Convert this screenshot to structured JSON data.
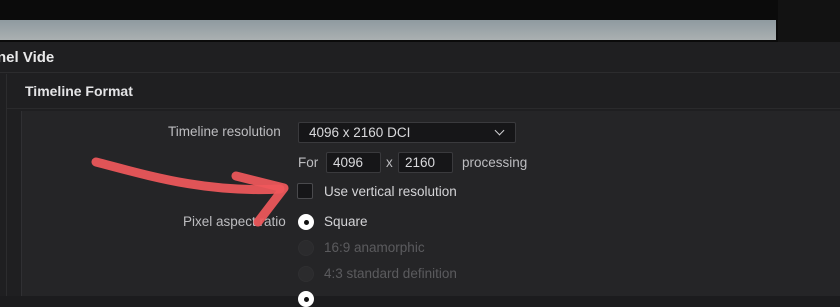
{
  "window": {
    "title": "nel Vide"
  },
  "section": {
    "title": "Timeline Format"
  },
  "timeline_resolution": {
    "label": "Timeline resolution",
    "selected": "4096 x 2160 DCI"
  },
  "processing": {
    "for_label": "For",
    "width": "4096",
    "x_label": "x",
    "height": "2160",
    "suffix": "processing"
  },
  "vertical": {
    "label": "Use vertical resolution",
    "checked": false
  },
  "pixel_aspect": {
    "label": "Pixel aspect ratio",
    "options": [
      {
        "label": "Square",
        "selected": true,
        "enabled": true
      },
      {
        "label": "16:9 anamorphic",
        "selected": false,
        "enabled": false
      },
      {
        "label": "4:3 standard definition",
        "selected": false,
        "enabled": false
      }
    ]
  },
  "colors": {
    "annotation_arrow": "#f0585b",
    "accent_text": "#d9d9dc"
  },
  "icons": {
    "dropdown": "chevron-down-icon"
  }
}
